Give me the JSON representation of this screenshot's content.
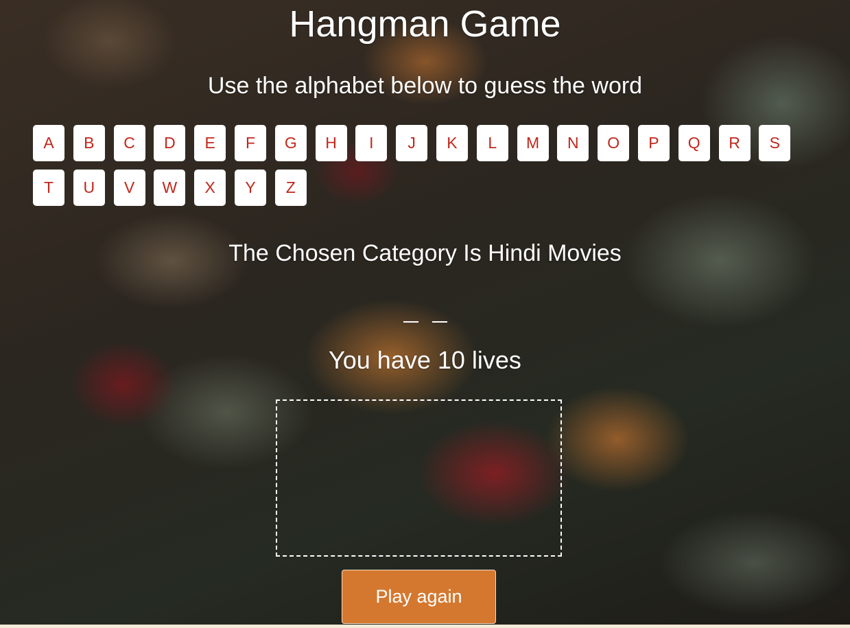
{
  "title": "Hangman Game",
  "instructions": "Use the alphabet below to guess the word",
  "alphabet": [
    "A",
    "B",
    "C",
    "D",
    "E",
    "F",
    "G",
    "H",
    "I",
    "J",
    "K",
    "L",
    "M",
    "N",
    "O",
    "P",
    "Q",
    "R",
    "S",
    "T",
    "U",
    "V",
    "W",
    "X",
    "Y",
    "Z"
  ],
  "category_text": "The Chosen Category Is Hindi Movies",
  "word_blanks": 2,
  "lives_text": "You have 10 lives",
  "play_again_label": "Play again",
  "colors": {
    "letter_text": "#c0271c",
    "letter_bg": "#ffffff",
    "play_again_bg": "#d4782f"
  }
}
